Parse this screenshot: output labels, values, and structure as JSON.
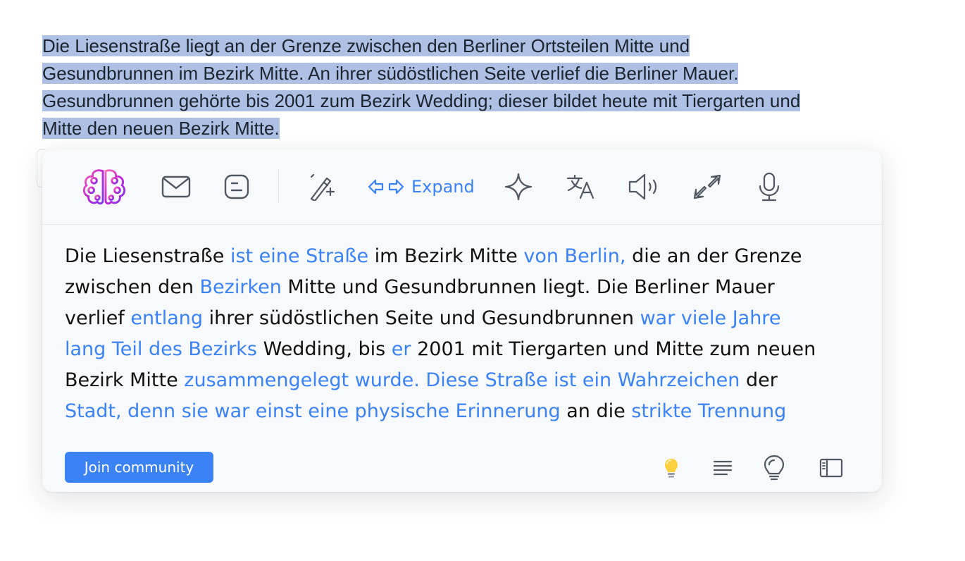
{
  "source": {
    "line1": "Die Liesenstraße liegt an der Grenze zwischen den Berliner Ortsteilen Mitte und",
    "line2": "Gesundbrunnen im Bezirk Mitte. An ihrer südöstlichen Seite verlief die Berliner Mauer.",
    "line3": "Gesundbrunnen gehörte bis 2001 zum Bezirk Wedding; dieser bildet heute mit Tiergarten und",
    "line4": "Mitte den neuen Bezirk Mitte."
  },
  "toolbar": {
    "expand_label": "Expand",
    "icons": [
      "brain-logo-icon",
      "mail-icon",
      "blogger-icon",
      "magic-wand-icon",
      "expand-arrows-icon",
      "sparkle-icon",
      "translate-icon",
      "speaker-icon",
      "compress-icon",
      "microphone-icon"
    ]
  },
  "result": {
    "segments": [
      {
        "t": "Die Liesenstraße ",
        "h": false
      },
      {
        "t": "ist eine Straße",
        "h": true
      },
      {
        "t": " im Bezirk Mitte ",
        "h": false
      },
      {
        "t": "von Berlin,",
        "h": true
      },
      {
        "t": " die an der Grenze zwischen den ",
        "h": false
      },
      {
        "t": "Bezirken",
        "h": true
      },
      {
        "t": " Mitte und Gesundbrunnen liegt. Die Berliner Mauer verlief ",
        "h": false
      },
      {
        "t": "entlang",
        "h": true
      },
      {
        "t": " ihrer südöstlichen Seite und Gesundbrunnen ",
        "h": false
      },
      {
        "t": "war viele Jahre lang Teil des Bezirks",
        "h": true
      },
      {
        "t": " Wedding, bis ",
        "h": false
      },
      {
        "t": "er",
        "h": true
      },
      {
        "t": " 2001 mit Tiergarten und Mitte zum neuen Bezirk Mitte ",
        "h": false
      },
      {
        "t": "zusammengelegt wurde. Diese Straße ist ein Wahrzeichen",
        "h": true
      },
      {
        "t": " der ",
        "h": false
      },
      {
        "t": "Stadt, denn sie war einst eine physische Erinnerung",
        "h": true
      },
      {
        "t": " an die ",
        "h": false
      },
      {
        "t": "strikte Trennung",
        "h": true
      }
    ]
  },
  "footer": {
    "join_label": "Join community",
    "icons": [
      "lightbulb-icon",
      "align-lines-icon",
      "idea-bulb-icon",
      "sidebar-panel-icon"
    ]
  },
  "colors": {
    "accent": "#3b82f6",
    "selection": "#aec0e3",
    "panel_bg": "#f8f9fb"
  }
}
